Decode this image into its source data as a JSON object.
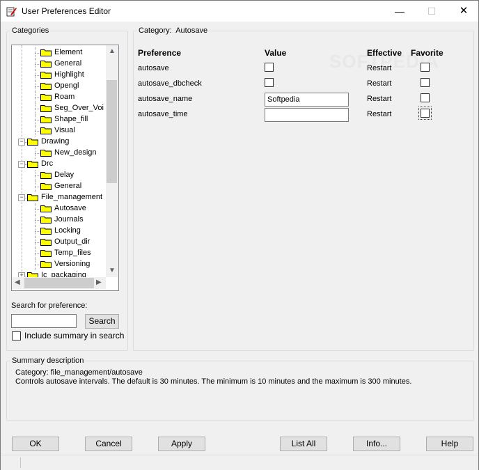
{
  "window": {
    "title": "User Preferences Editor",
    "icon": "app-pencil-icon"
  },
  "categories": {
    "label": "Categories",
    "tree": [
      {
        "label": "Element",
        "level": 2
      },
      {
        "label": "General",
        "level": 2
      },
      {
        "label": "Highlight",
        "level": 2
      },
      {
        "label": "Opengl",
        "level": 2
      },
      {
        "label": "Roam",
        "level": 2
      },
      {
        "label": "Seg_Over_Voi",
        "level": 2
      },
      {
        "label": "Shape_fill",
        "level": 2
      },
      {
        "label": "Visual",
        "level": 2
      },
      {
        "label": "Drawing",
        "level": 1,
        "expander": "−"
      },
      {
        "label": "New_design",
        "level": 2
      },
      {
        "label": "Drc",
        "level": 1,
        "expander": "−"
      },
      {
        "label": "Delay",
        "level": 2
      },
      {
        "label": "General",
        "level": 2
      },
      {
        "label": "File_management",
        "level": 1,
        "expander": "−"
      },
      {
        "label": "Autosave",
        "level": 2
      },
      {
        "label": "Journals",
        "level": 2
      },
      {
        "label": "Locking",
        "level": 2
      },
      {
        "label": "Output_dir",
        "level": 2
      },
      {
        "label": "Temp_files",
        "level": 2
      },
      {
        "label": "Versioning",
        "level": 2
      },
      {
        "label": "Ic_packaging",
        "level": 1,
        "expander": "+"
      }
    ]
  },
  "search": {
    "label": "Search for preference:",
    "value": "",
    "button": "Search",
    "include_summary_label": "Include summary in search",
    "include_summary_checked": false
  },
  "category_panel": {
    "prefix": "Category:",
    "name": "Autosave",
    "headers": {
      "preference": "Preference",
      "value": "Value",
      "effective": "Effective",
      "favorite": "Favorite"
    },
    "rows": [
      {
        "name": "autosave",
        "value_type": "checkbox",
        "value": "",
        "effective": "Restart"
      },
      {
        "name": "autosave_dbcheck",
        "value_type": "checkbox",
        "value": "",
        "effective": "Restart"
      },
      {
        "name": "autosave_name",
        "value_type": "text",
        "value": "Softpedia",
        "effective": "Restart"
      },
      {
        "name": "autosave_time",
        "value_type": "text",
        "value": "",
        "effective": "Restart"
      }
    ]
  },
  "watermark": "SOFTPEDIA",
  "summary": {
    "label": "Summary description",
    "line1": "Category: file_management/autosave",
    "line2": "Controls autosave intervals. The default is 30 minutes. The minimum is 10 minutes and the maximum is 300 minutes."
  },
  "buttons": {
    "ok": "OK",
    "cancel": "Cancel",
    "apply": "Apply",
    "list_all": "List All",
    "info": "Info...",
    "help": "Help"
  },
  "colors": {
    "folder_fill": "#ffff00",
    "folder_stroke": "#000000",
    "icon_red": "#d40000"
  }
}
